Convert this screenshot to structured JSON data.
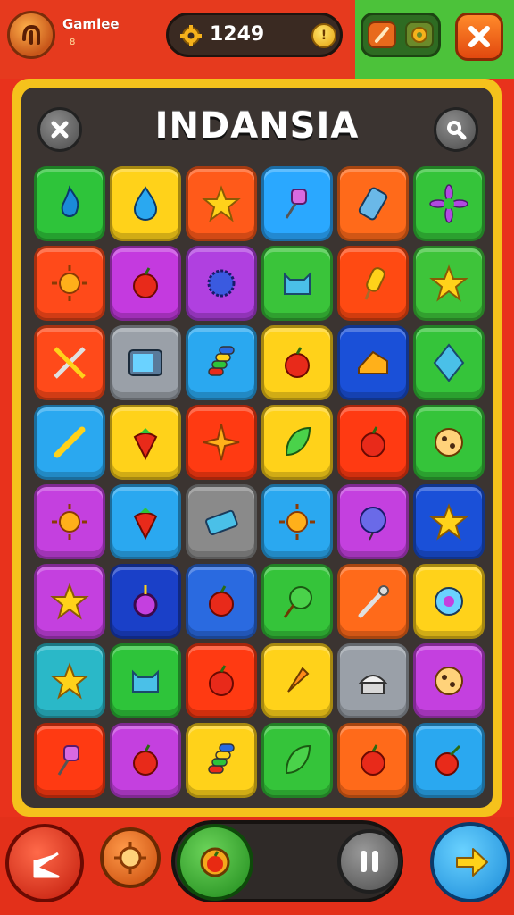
{
  "header": {
    "player_name": "Gamlee",
    "player_level": "8",
    "coins": "1249",
    "coin_symbol": "!"
  },
  "board": {
    "title": "INDANSIA",
    "rows": [
      [
        {
          "color": "#2ec43a",
          "icon": "flame-icon"
        },
        {
          "color": "#ffd21a",
          "icon": "drop-icon"
        },
        {
          "color": "#ff5a1a",
          "icon": "star-icon"
        },
        {
          "color": "#2aa8ff",
          "icon": "pushpin-icon"
        },
        {
          "color": "#ff6a1a",
          "icon": "phone-icon"
        },
        {
          "color": "#35c43a",
          "icon": "flower-icon"
        }
      ],
      [
        {
          "color": "#ff4a1a",
          "icon": "sun-icon"
        },
        {
          "color": "#c43adf",
          "icon": "apple-icon"
        },
        {
          "color": "#b040e0",
          "icon": "spiky-ball-icon"
        },
        {
          "color": "#3ac43a",
          "icon": "cat-icon"
        },
        {
          "color": "#ff4a12",
          "icon": "popsicle-icon"
        },
        {
          "color": "#3ec43a",
          "icon": "star-icon"
        }
      ],
      [
        {
          "color": "#ff4a1a",
          "icon": "crossed-swords-icon"
        },
        {
          "color": "#9aa0a8",
          "icon": "tv-icon"
        },
        {
          "color": "#2aa8f0",
          "icon": "candy-stack-icon"
        },
        {
          "color": "#ffd21a",
          "icon": "apple-icon"
        },
        {
          "color": "#1a50d8",
          "icon": "cheese-icon"
        },
        {
          "color": "#35c43a",
          "icon": "kite-icon"
        }
      ],
      [
        {
          "color": "#2aa8f0",
          "icon": "rolling-pin-icon"
        },
        {
          "color": "#ffd21a",
          "icon": "strawberry-icon"
        },
        {
          "color": "#ff3a12",
          "icon": "leaf-star-icon"
        },
        {
          "color": "#ffd21a",
          "icon": "leaf-icon"
        },
        {
          "color": "#ff3a12",
          "icon": "apple-icon"
        },
        {
          "color": "#35c43a",
          "icon": "cookie-icon"
        }
      ],
      [
        {
          "color": "#c440df",
          "icon": "sun-icon"
        },
        {
          "color": "#2aa8f0",
          "icon": "strawberry-icon"
        },
        {
          "color": "#8a8a8a",
          "icon": "block-icon"
        },
        {
          "color": "#2aa8f0",
          "icon": "sun-icon"
        },
        {
          "color": "#c440df",
          "icon": "balloon-icon"
        },
        {
          "color": "#1a50d8",
          "icon": "star-icon"
        }
      ],
      [
        {
          "color": "#c440df",
          "icon": "star-icon"
        },
        {
          "color": "#1a40c8",
          "icon": "bomb-icon"
        },
        {
          "color": "#2a6ae0",
          "icon": "apple-icon"
        },
        {
          "color": "#35c43a",
          "icon": "lollipop-icon"
        },
        {
          "color": "#ff6a1a",
          "icon": "wand-icon"
        },
        {
          "color": "#ffd21a",
          "icon": "donut-icon"
        }
      ],
      [
        {
          "color": "#2ab8c8",
          "icon": "star-icon"
        },
        {
          "color": "#2ec43a",
          "icon": "cat-icon"
        },
        {
          "color": "#ff3a12",
          "icon": "apple-icon"
        },
        {
          "color": "#ffd21a",
          "icon": "carrot-icon"
        },
        {
          "color": "#9aa0a8",
          "icon": "cupcake-icon"
        },
        {
          "color": "#c440df",
          "icon": "cookie-icon"
        }
      ],
      [
        {
          "color": "#ff3a12",
          "icon": "pushpin-icon"
        },
        {
          "color": "#c440df",
          "icon": "apple-icon"
        },
        {
          "color": "#ffd21a",
          "icon": "candy-stack-icon"
        },
        {
          "color": "#35c43a",
          "icon": "leaf-icon"
        },
        {
          "color": "#ff6a1a",
          "icon": "apple-icon"
        },
        {
          "color": "#2aa8f0",
          "icon": "cherry-icon"
        }
      ]
    ]
  }
}
